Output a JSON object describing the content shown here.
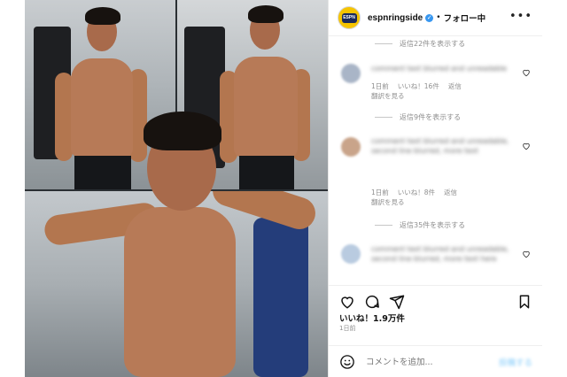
{
  "header": {
    "username": "espnringside",
    "avatar_label": "ESPN",
    "follow_label": "フォロー中",
    "dot": "•"
  },
  "comments": {
    "view_replies_1": "返信22件を表示する",
    "view_replies_2": "返信9件を表示する",
    "view_replies_3": "返信35件を表示する",
    "comment1": {
      "text": "comment text blurred and unreadable",
      "time": "1日前",
      "likes": "いいね！16件",
      "reply": "返信",
      "translate": "翻訳を見る"
    },
    "comment2": {
      "text": "comment text blurred and unreadable, second line blurred, more text",
      "time": "1日前",
      "likes": "いいね！8件",
      "reply": "返信",
      "translate": "翻訳を見る"
    },
    "comment3": {
      "text": "comment text blurred and unreadable, second line blurred, more text here"
    }
  },
  "footer": {
    "likes": "いいね！1.9万件",
    "time": "1日前",
    "comment_placeholder": "コメントを追加...",
    "post_label": "投稿する"
  },
  "colors": {
    "verified": "#3897f0",
    "post_button": "#b2dffc"
  }
}
